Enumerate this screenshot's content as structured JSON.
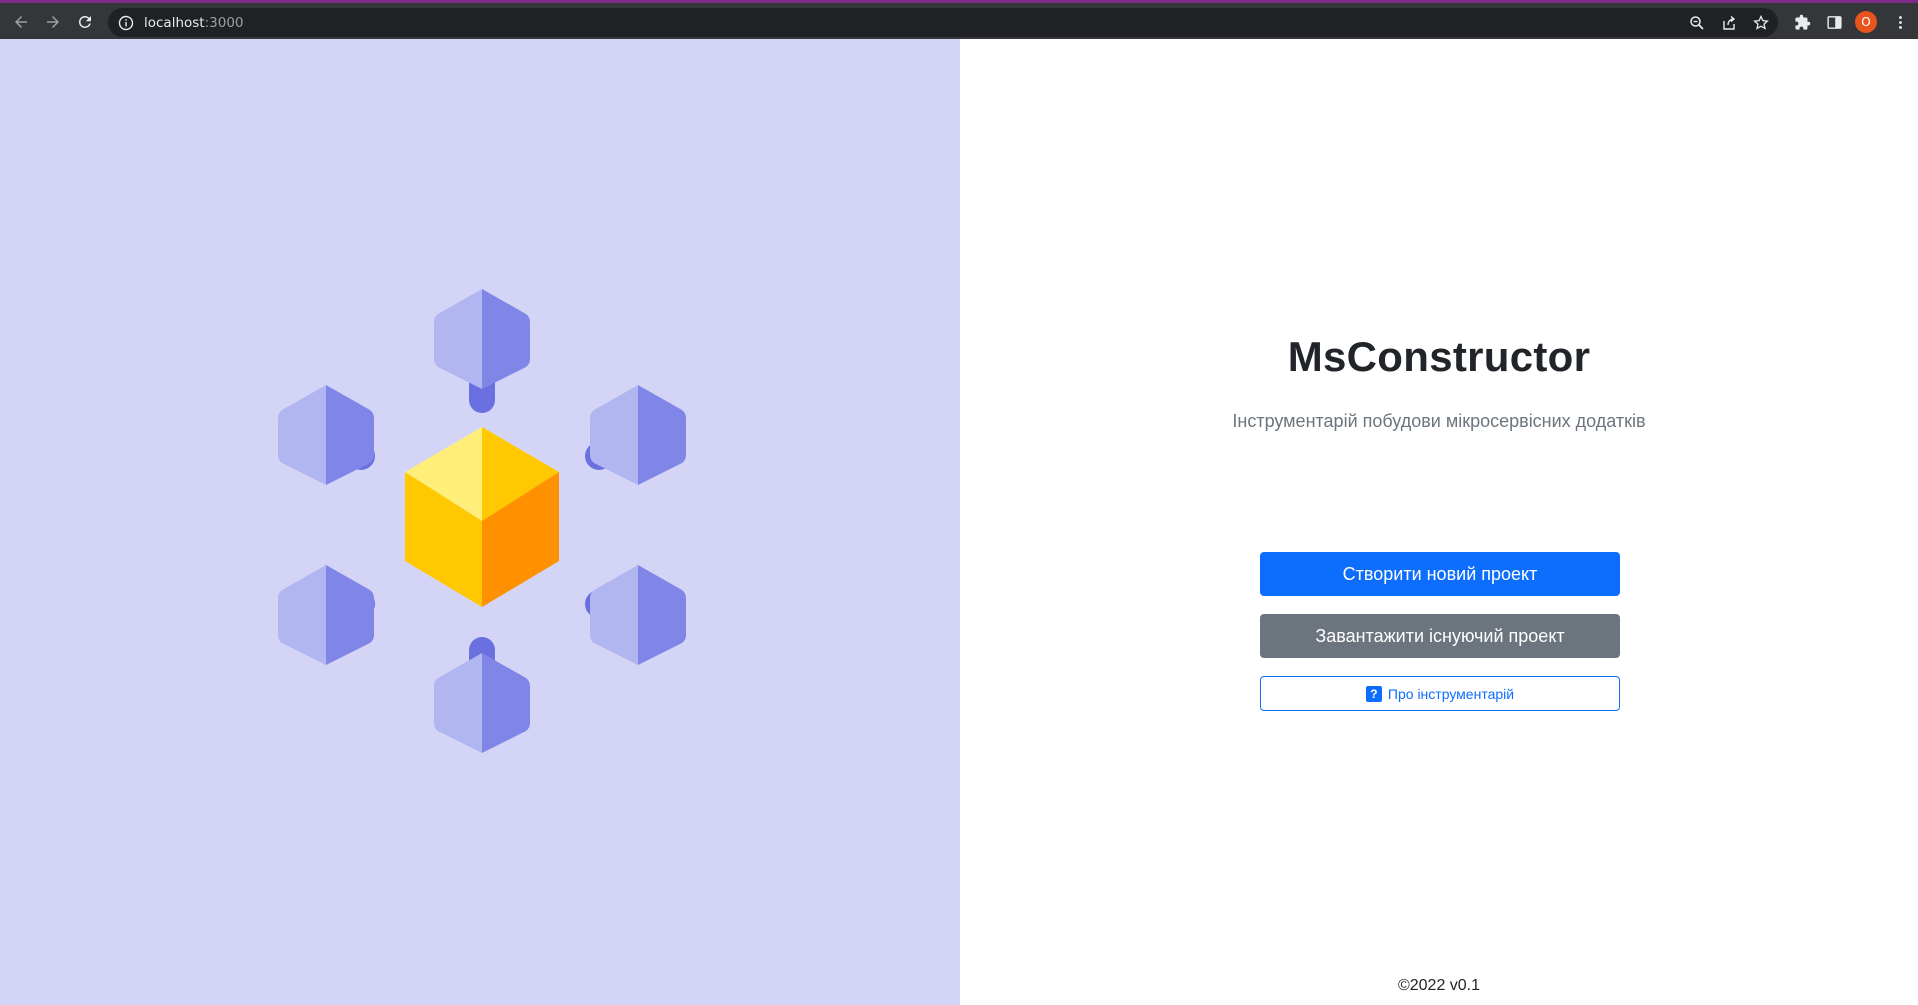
{
  "browser": {
    "url_host": "localhost",
    "url_port": ":3000",
    "profile_initial": "O"
  },
  "main": {
    "title": "MsConstructor",
    "subtitle": "Інструментарій побудови мікросервісних додатків",
    "buttons": {
      "create": "Створити новий проект",
      "load": "Завантажити існуючий проект",
      "about": "Про інструментарій",
      "about_icon": "?"
    },
    "footer": "©2022 v0.1"
  },
  "colors": {
    "left_pane_bg": "#d4d5f6",
    "primary": "#0d6efd",
    "secondary": "#6c757d",
    "cube_light": "#ffee7a",
    "cube_mid": "#ffc800",
    "cube_dark": "#ff9100",
    "hex_light": "#b1b5f0",
    "hex_dark": "#8085e8",
    "connector": "#6a70e0"
  },
  "icons": {
    "back": "back-arrow-icon",
    "forward": "forward-arrow-icon",
    "reload": "reload-icon",
    "site_info": "info-icon",
    "zoom": "zoom-icon",
    "share": "share-icon",
    "bookmark": "star-icon",
    "extensions": "puzzle-icon",
    "side_panel": "side-panel-icon",
    "menu": "kebab-menu-icon"
  }
}
